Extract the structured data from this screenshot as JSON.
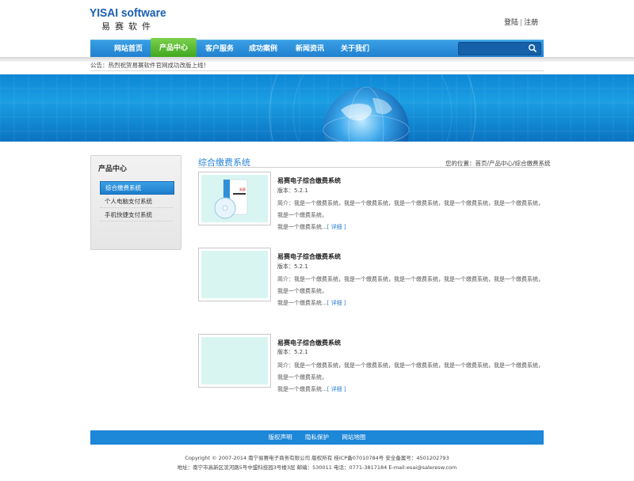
{
  "header": {
    "logo_en": "YISAI software",
    "logo_cn": "易赛软件",
    "login": "登陆",
    "register": "注册"
  },
  "nav": {
    "items": [
      "网站首页",
      "产品中心",
      "客户服务",
      "成功案例",
      "新闻资讯",
      "关于我们"
    ],
    "active_index": 1,
    "search_placeholder": ""
  },
  "notice": "公告：热烈祝贺易赛软件官网成功改版上线！",
  "sidebar": {
    "title": "产品中心",
    "items": [
      "综合缴费系统",
      "个人电脑支付系统",
      "手机快捷支付系统"
    ],
    "active_index": 0
  },
  "content": {
    "title": "综合缴费系统",
    "breadcrumb": "您的位置：首页/产品中心/综合缴费系统",
    "products": [
      {
        "title": "易赛电子综合缴费系统",
        "version": "版本：5.2.1",
        "desc": "简介：我是一个缴费系统，我是一个缴费系统，我是一个缴费系统，我是一个缴费系统，我是一个缴费系统，我是一个缴费系统，",
        "desc2": "我是一个缴费系统...",
        "more": "[ 详细 ]"
      },
      {
        "title": "易赛电子综合缴费系统",
        "version": "版本：5.2.1",
        "desc": "简介：我是一个缴费系统，我是一个缴费系统，我是一个缴费系统，我是一个缴费系统，我是一个缴费系统，我是一个缴费系统，",
        "desc2": "我是一个缴费系统...",
        "more": "[ 详细 ]"
      },
      {
        "title": "易赛电子综合缴费系统",
        "version": "版本：5.2.1",
        "desc": "简介：我是一个缴费系统，我是一个缴费系统，我是一个缴费系统，我是一个缴费系统，我是一个缴费系统，我是一个缴费系统，",
        "desc2": "我是一个缴费系统...",
        "more": "[ 详细 ]"
      }
    ]
  },
  "footer": {
    "links": [
      "版权声明",
      "隐私保护",
      "网站地图"
    ],
    "copyright": "Copyright © 2007-2014 南宁易赛电子商务有限公司 版权所有 桂ICP备07010784号 安全备案号：4501202793",
    "address": "地址：南宁市高新区滨河路5号中盟科技园3号楼3层 邮编：530011 电话：0771-3817184 E-mail:esai@saleresw.com"
  },
  "colors": {
    "accent": "#1d87d8",
    "nav_active": "#4fb528",
    "title": "#2a86d6"
  }
}
